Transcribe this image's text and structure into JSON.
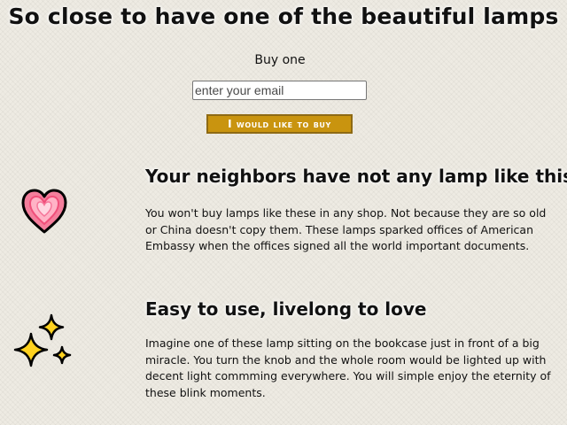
{
  "page": {
    "title": "So close to have one of the beautiful lamps"
  },
  "buy_form": {
    "label": "Buy one",
    "email_placeholder": "enter your email",
    "button_label": "I would like to buy"
  },
  "sections": [
    {
      "icon": "heart-icon",
      "heading": "Your neighbors have not any lamp like this",
      "text": "You won't buy lamps like these in any shop. Not because they are so old or China doesn't copy them. These lamps sparked offices of American Embassy when the offices signed all the world important documents."
    },
    {
      "icon": "sparkles-icon",
      "heading": "Easy to use, livelong to love",
      "text": "Imagine one of these lamp sitting on the bookcase just in front of a big miracle. You turn the knob and the whole room would be lighted up with decent light commming everywhere. You will simple enjoy the eternity of these blink moments."
    }
  ],
  "colors": {
    "background": "#eeebe3",
    "button_background": "#c9940f",
    "button_text": "#ffffff",
    "heart": "#f47e9c",
    "sparkle": "#ffd21f"
  }
}
